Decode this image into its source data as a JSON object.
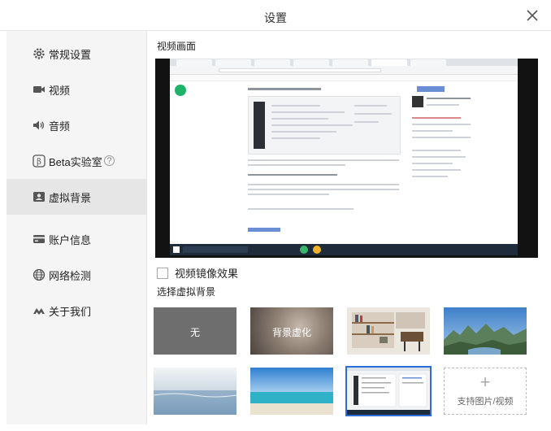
{
  "window": {
    "title": "设置"
  },
  "sidebar": {
    "items": [
      {
        "label": "常规设置",
        "icon": "gear-icon"
      },
      {
        "label": "视频",
        "icon": "video-camera-icon"
      },
      {
        "label": "音频",
        "icon": "speaker-icon"
      },
      {
        "label": "Beta实验室",
        "icon": "beta-icon",
        "help": "?"
      },
      {
        "label": "虚拟背景",
        "icon": "portrait-icon",
        "active": true
      },
      {
        "label": "账户信息",
        "icon": "card-icon"
      },
      {
        "label": "网络检测",
        "icon": "globe-icon"
      },
      {
        "label": "关于我们",
        "icon": "logo-icon"
      }
    ]
  },
  "main": {
    "preview_title": "视频画面",
    "mirror_label": "视频镜像效果",
    "choose_title": "选择虚拟背景",
    "backgrounds": [
      {
        "label": "无",
        "kind": "none"
      },
      {
        "label": "背景虚化",
        "kind": "blur"
      },
      {
        "label": "",
        "kind": "bookshelf"
      },
      {
        "label": "",
        "kind": "mountains"
      },
      {
        "label": "",
        "kind": "ocean"
      },
      {
        "label": "",
        "kind": "beach"
      },
      {
        "label": "",
        "kind": "screen-capture",
        "selected": true
      },
      {
        "label": "支持图片/视频",
        "kind": "add",
        "icon": "plus-icon"
      }
    ]
  },
  "colors": {
    "accent": "#2b6fd6",
    "sidebar_bg": "#f5f5f5",
    "active_bg": "#e6e6e6"
  }
}
